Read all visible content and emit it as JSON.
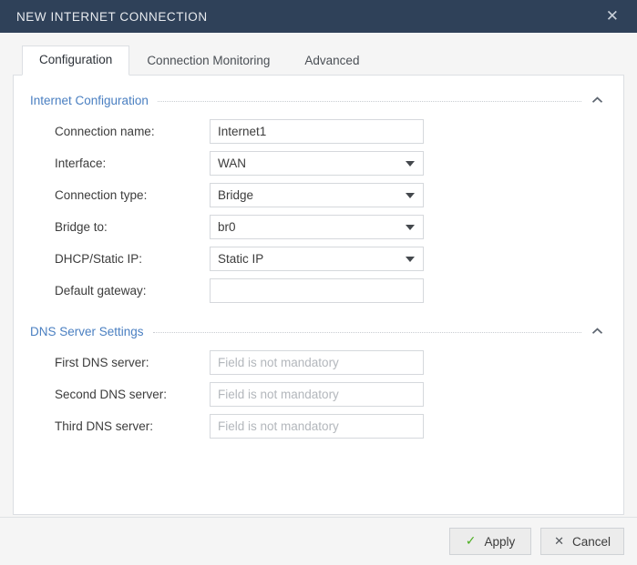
{
  "window": {
    "title": "NEW INTERNET CONNECTION",
    "close_icon": "close-icon",
    "close_glyph": "✕",
    "titlebar_color": "#2f4159"
  },
  "tabs": [
    {
      "label": "Configuration",
      "active": true
    },
    {
      "label": "Connection Monitoring",
      "active": false
    },
    {
      "label": "Advanced",
      "active": false
    }
  ],
  "sections": [
    {
      "title": "Internet Configuration",
      "collapse_icon": "chevron-up-icon",
      "accent_color": "#4a7fc1",
      "rows": [
        {
          "label": "Connection name:",
          "type": "text",
          "value": "Internet1",
          "placeholder": ""
        },
        {
          "label": "Interface:",
          "type": "select",
          "value": "WAN",
          "placeholder": ""
        },
        {
          "label": "Connection type:",
          "type": "select",
          "value": "Bridge",
          "placeholder": ""
        },
        {
          "label": "Bridge to:",
          "type": "select",
          "value": "br0",
          "placeholder": ""
        },
        {
          "label": "DHCP/Static IP:",
          "type": "select",
          "value": "Static IP",
          "placeholder": ""
        },
        {
          "label": "Default gateway:",
          "type": "text",
          "value": "",
          "placeholder": ""
        }
      ]
    },
    {
      "title": "DNS Server Settings",
      "collapse_icon": "chevron-up-icon",
      "accent_color": "#4a7fc1",
      "rows": [
        {
          "label": "First DNS server:",
          "type": "text",
          "value": "",
          "placeholder": "Field is not mandatory"
        },
        {
          "label": "Second DNS server:",
          "type": "text",
          "value": "",
          "placeholder": "Field is not mandatory"
        },
        {
          "label": "Third DNS server:",
          "type": "text",
          "value": "",
          "placeholder": "Field is not mandatory"
        }
      ]
    }
  ],
  "footer": {
    "apply": {
      "label": "Apply",
      "icon": "check-icon",
      "glyph": "✓",
      "color": "#4caf21"
    },
    "cancel": {
      "label": "Cancel",
      "icon": "close-icon",
      "glyph": "✕",
      "color": "#55595e"
    }
  }
}
